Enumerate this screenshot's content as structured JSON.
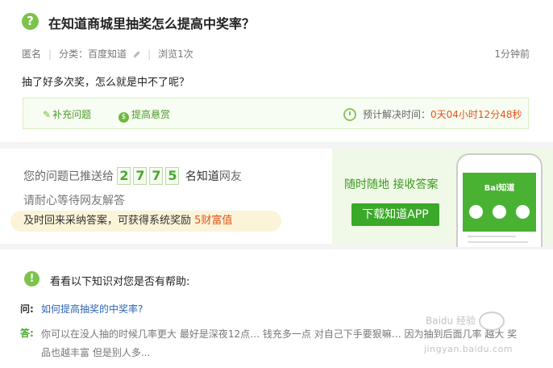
{
  "question": {
    "icon": "question-icon",
    "title": "在知道商城里抽奖怎么提高中奖率？",
    "author": "匿名",
    "category": "分类：百度知道",
    "views": "浏览1次",
    "time": "1分钟前",
    "body": "抽了好多次奖，怎么就是中不了呢？"
  },
  "actions": {
    "supplement": "补充问题",
    "reward": "提高悬赏",
    "estimate_label": "预计解决时间：",
    "estimate_value": "0天04小时12分48秒"
  },
  "push": {
    "prefix": "您的问题已推送给",
    "digits": [
      "2",
      "7",
      "7",
      "5"
    ],
    "suffix_strong": "名知道",
    "suffix": "网友",
    "wait": "请耐心等待网友解答",
    "reward_text": "及时回来采纳答案，可获得系统奖励",
    "reward_amount": "5财富值"
  },
  "app_promo": {
    "slogan": "随时随地  接收答案",
    "download": "下载知道APP",
    "app_name": "Bai知道"
  },
  "related": {
    "title": "看看以下知识对您是否有帮助:",
    "q_label": "问:",
    "q_link": "如何提高抽奖的中奖率?",
    "a_label": "答:",
    "a_text": "你可以在没人抽的时候几率更大 最好是深夜12点… 钱充多一点 对自己下手要狠嘛… 因为抽到后面几率 越大 奖品也越丰富 但是别人多..."
  },
  "watermark": {
    "text": "Baidu 经验",
    "url": "jingyan.baidu.com"
  },
  "colors": {
    "accent_green": "#4ba72f",
    "countdown_red": "#e4541a",
    "link_blue": "#2d64b3"
  }
}
